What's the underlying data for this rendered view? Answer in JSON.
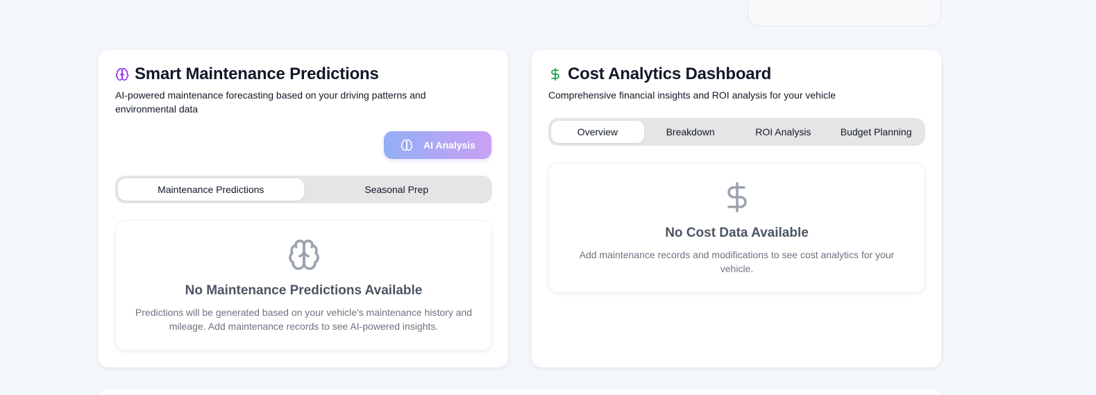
{
  "maintenance": {
    "title": "Smart Maintenance Predictions",
    "description": "AI-powered maintenance forecasting based on your driving patterns and environmental data",
    "ai_button_label": "AI Analysis",
    "tabs": [
      {
        "label": "Maintenance Predictions",
        "active": true
      },
      {
        "label": "Seasonal Prep",
        "active": false
      }
    ],
    "empty_title": "No Maintenance Predictions Available",
    "empty_text": "Predictions will be generated based on your vehicle's maintenance history and mileage. Add maintenance records to see AI-powered insights.",
    "icon": "brain-icon",
    "accent_color": "#9333ea"
  },
  "cost": {
    "title": "Cost Analytics Dashboard",
    "description": "Comprehensive financial insights and ROI analysis for your vehicle",
    "tabs": [
      {
        "label": "Overview",
        "active": true
      },
      {
        "label": "Breakdown",
        "active": false
      },
      {
        "label": "ROI Analysis",
        "active": false
      },
      {
        "label": "Budget Planning",
        "active": false
      }
    ],
    "empty_title": "No Cost Data Available",
    "empty_text": "Add maintenance records and modifications to see cost analytics for your vehicle.",
    "icon": "dollar-sign-icon",
    "accent_color": "#16a34a"
  },
  "colors": {
    "page_bg": "#f3f6fa",
    "tab_bg": "#e5e5e5",
    "button_gradient_start": "#93aef5",
    "button_gradient_end": "#c9a0f5",
    "empty_icon": "#9ca3af"
  }
}
